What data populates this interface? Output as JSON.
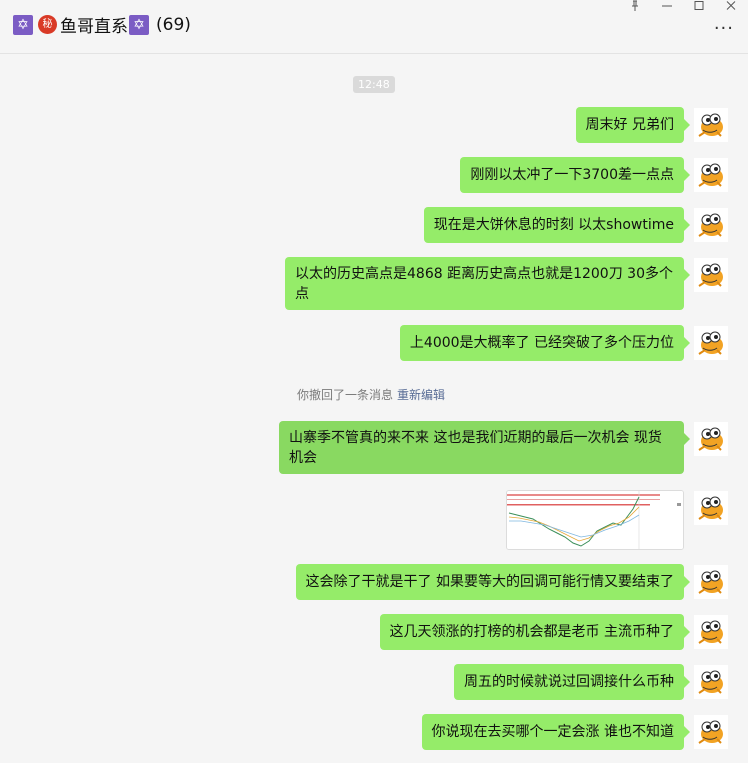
{
  "header": {
    "chat_name": "鱼哥直系",
    "member_count": "(69)",
    "star_icon": "✡",
    "secret_badge": "秘"
  },
  "timestamp": "12:48",
  "recall": {
    "text": "你撤回了一条消息",
    "edit_label": "重新编辑"
  },
  "messages": [
    {
      "text": "周末好 兄弟们"
    },
    {
      "text": "刚刚以太冲了一下3700差一点点"
    },
    {
      "text": "现在是大饼休息的时刻 以太showtime"
    },
    {
      "text": "以太的历史高点是4868   距离历史高点也就是1200刀   30多个点"
    },
    {
      "text": "上4000是大概率了    已经突破了多个压力位"
    },
    {
      "text": "山寨季不管真的来不来    这也是我们近期的最后一次机会  现货机会"
    },
    {
      "text": "这会除了干就是干了     如果要等大的回调可能行情又要结束了"
    },
    {
      "text": "这几天领涨的打榜的机会都是老币 主流币种了"
    },
    {
      "text": "周五的时候就说过回调接什么币种"
    },
    {
      "text": "你说现在去买哪个一定会涨  谁也不知道"
    }
  ],
  "colors": {
    "bubble": "#95ec69",
    "background": "#f5f5f5",
    "link": "#576b95"
  }
}
